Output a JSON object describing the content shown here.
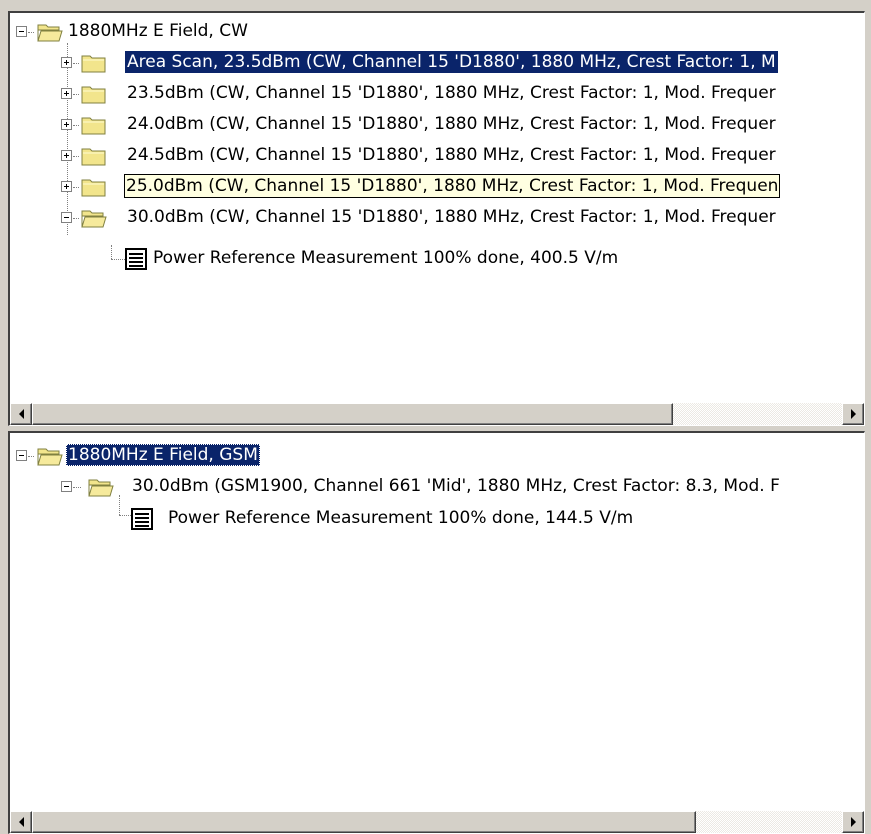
{
  "pane1": {
    "root": {
      "label": "1880MHz E Field, CW",
      "expanded": true
    },
    "children": [
      {
        "label": "Area Scan, 23.5dBm (CW, Channel 15 'D1880', 1880 MHz, Crest Factor: 1, M",
        "expanded": false,
        "selected": true
      },
      {
        "label": "23.5dBm (CW, Channel 15 'D1880', 1880 MHz, Crest Factor: 1, Mod. Frequer",
        "expanded": false
      },
      {
        "label": "24.0dBm (CW, Channel 15 'D1880', 1880 MHz, Crest Factor: 1, Mod. Frequer",
        "expanded": false
      },
      {
        "label": "24.5dBm (CW, Channel 15 'D1880', 1880 MHz, Crest Factor: 1, Mod. Frequer",
        "expanded": false
      },
      {
        "label": "25.0dBm (CW, Channel 15 'D1880', 1880 MHz, Crest Factor: 1, Mod. Frequen",
        "expanded": false,
        "hovered": true
      },
      {
        "label": "30.0dBm (CW, Channel 15 'D1880', 1880 MHz, Crest Factor: 1, Mod. Frequer",
        "expanded": true
      }
    ],
    "leaf": {
      "label": "Power Reference Measurement 100% done, 400.5 V/m"
    }
  },
  "pane2": {
    "root": {
      "label": "1880MHz E Field, GSM",
      "expanded": true,
      "selected": true
    },
    "child": {
      "label": "30.0dBm (GSM1900, Channel 661 'Mid', 1880 MHz, Crest Factor: 8.3, Mod. F",
      "expanded": true
    },
    "leaf": {
      "label": "Power Reference Measurement 100% done, 144.5 V/m"
    }
  },
  "scrollbars": {
    "pane1_thumb_fraction": 0.78,
    "pane2_thumb_fraction": 0.82
  },
  "colors": {
    "selection": "#0a246a",
    "hover_bg": "#ffffe1",
    "folder": "#f2e58c",
    "chrome": "#d4d0c8"
  }
}
